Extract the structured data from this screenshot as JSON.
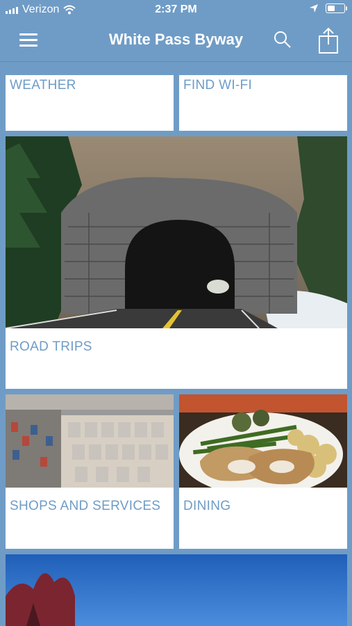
{
  "status_bar": {
    "carrier": "Verizon",
    "time": "2:37 PM"
  },
  "nav": {
    "title": "White Pass Byway"
  },
  "tiles": [
    {
      "label": "WEATHER"
    },
    {
      "label": "FIND WI-FI"
    },
    {
      "label": "ROAD TRIPS"
    },
    {
      "label": "SHOPS AND SERVICES"
    },
    {
      "label": "DINING"
    }
  ],
  "colors": {
    "accent": "#6f9cc6",
    "label": "#6f9cc6",
    "tile": "#ffffff"
  },
  "icons": [
    "menu-icon",
    "search-icon",
    "share-icon",
    "wifi-icon",
    "location-arrow-icon",
    "battery-icon"
  ]
}
